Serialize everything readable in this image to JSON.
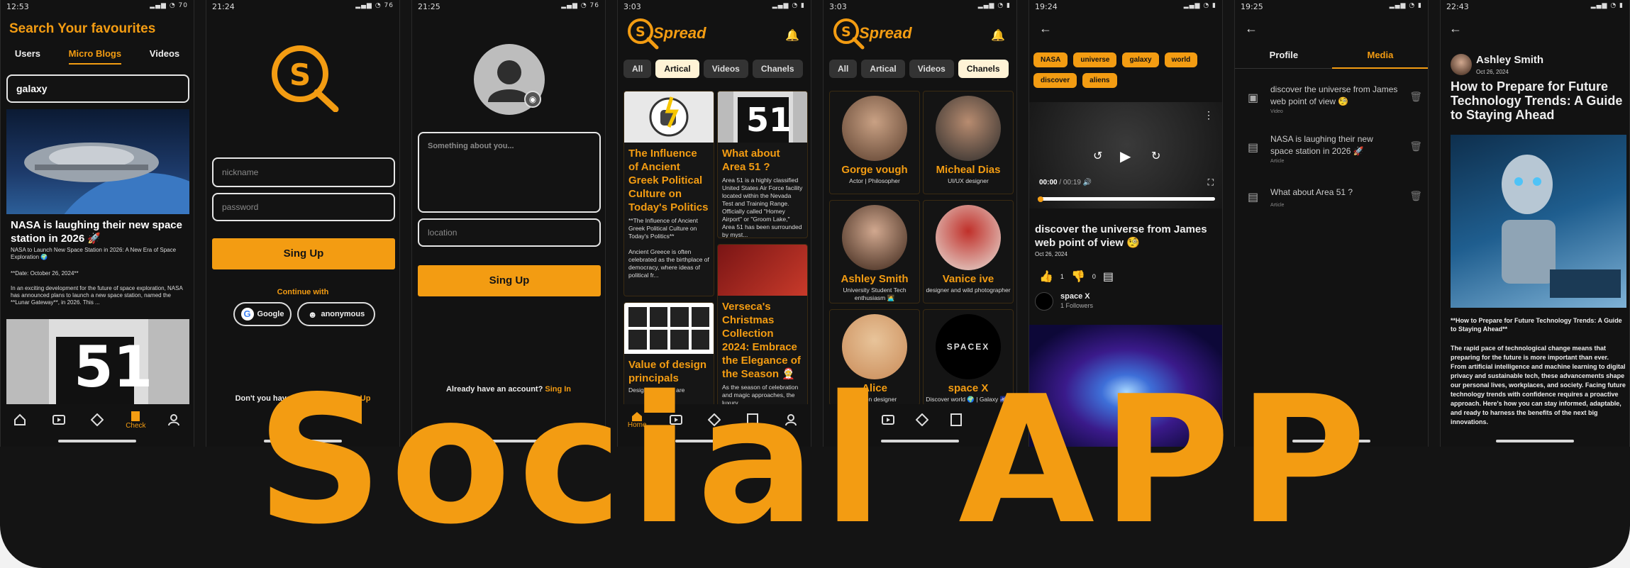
{
  "banner": "Social APP",
  "accent": "#f39c12",
  "s1": {
    "time": "12:53",
    "title": "Search Your favourites",
    "tabs": [
      "Users",
      "Micro Blogs",
      "Videos"
    ],
    "search": "galaxy",
    "post_title": "NASA is laughing their new space station in 2026 🚀",
    "post_sub": "NASA to Launch New Space Station in 2026: A New Era of Space Exploration 🌍",
    "post_date": "**Date: October 26, 2024**",
    "post_body": "In an exciting development for the future of space exploration, NASA has announced plans to launch a new space station, named the **Lunar Gateway**, in 2026. This ...",
    "nav_check": "Check"
  },
  "s2": {
    "time": "21:24",
    "nickname": "nickname",
    "password": "password",
    "btn": "Sing Up",
    "continue": "Continue with",
    "google": "Google",
    "anon": "anonymous",
    "footer": "Don't you have an account?",
    "footer_link": "Sing Up"
  },
  "s3": {
    "time": "21:25",
    "about": "Something about you...",
    "location": "location",
    "btn": "Sing Up",
    "footer": "Already have an account?",
    "footer_link": "Sing In"
  },
  "s4": {
    "time": "3:03",
    "brand": "Spread",
    "tabs": [
      "All",
      "Artical",
      "Videos",
      "Chanels"
    ],
    "c1_title": "The Influence of Ancient Greek Political Culture on Today's Politics",
    "c1_body": "**The Influence of Ancient Greek Political Culture on Today's Politics**\n\nAncient Greece is often celebrated as the birthplace of democracy, where ideas of political fr...",
    "c2_title": "What about Area 51 ?",
    "c2_body": "Area 51 is a highly classified United States Air Force facility located within the Nevada Test and Training Range. Officially called \"Homey Airport\" or \"Groom Lake,\" Area 51 has been surrounded by myst...",
    "c3_title": "Value of design principals",
    "c3_body": "Design principles are",
    "c4_title": "Verseca's Christmas Collection 2024: Embrace the Elegance of the Season 🤶",
    "c4_body": "As the season of celebration and magic approaches, the luxury",
    "nav_home": "Home"
  },
  "s5": {
    "time": "3:03",
    "brand": "Spread",
    "tabs": [
      "All",
      "Artical",
      "Videos",
      "Chanels"
    ],
    "channels": [
      {
        "name": "Gorge vough",
        "desc": "Actor | Philosopher"
      },
      {
        "name": "Micheal Dias",
        "desc": "UI/UX designer"
      },
      {
        "name": "Ashley Smith",
        "desc": "University Student Tech enthusiasm 🧑‍💻"
      },
      {
        "name": "Vanice ive",
        "desc": "designer and wild photographer"
      },
      {
        "name": "Alice",
        "desc": "fashion designer"
      },
      {
        "name": "space X",
        "desc": "Discover world 🌍 | Galaxy 🌌 | Universe 🪐"
      }
    ]
  },
  "s6": {
    "time": "19:24",
    "tags": [
      "NASA",
      "universe",
      "galaxy",
      "world",
      "discover",
      "aliens"
    ],
    "vtime": "00:00",
    "vdur": "/ 00:19",
    "title": "discover the universe from James web point of view 🧐",
    "date": "Oct 26, 2024",
    "likes": "1",
    "dislikes": "0",
    "channel": "space X",
    "followers": "1 Followers"
  },
  "s7": {
    "time": "19:25",
    "tabs": [
      "Profile",
      "Media"
    ],
    "items": [
      {
        "title": "discover the universe from James web point of view 🧐",
        "type": "Video"
      },
      {
        "title": "NASA is laughing their new space station in 2026 🚀",
        "type": "Article"
      },
      {
        "title": "What about Area 51 ?",
        "type": "Article"
      }
    ]
  },
  "s8": {
    "time": "22:43",
    "author": "Ashley Smith",
    "date": "Oct 26, 2024",
    "title": "How to Prepare for Future Technology Trends: A Guide to Staying Ahead",
    "sub": "**How to Prepare for Future Technology Trends: A Guide to Staying Ahead**",
    "body": "The rapid pace of technological change means that preparing for the future is more important than ever. From artificial intelligence and machine learning to digital privacy and sustainable tech, these advancements shape our personal lives, workplaces, and society. Facing future technology trends with confidence requires a proactive approach. Here's how you can stay informed, adaptable, and ready to harness the benefits of the next big innovations."
  }
}
